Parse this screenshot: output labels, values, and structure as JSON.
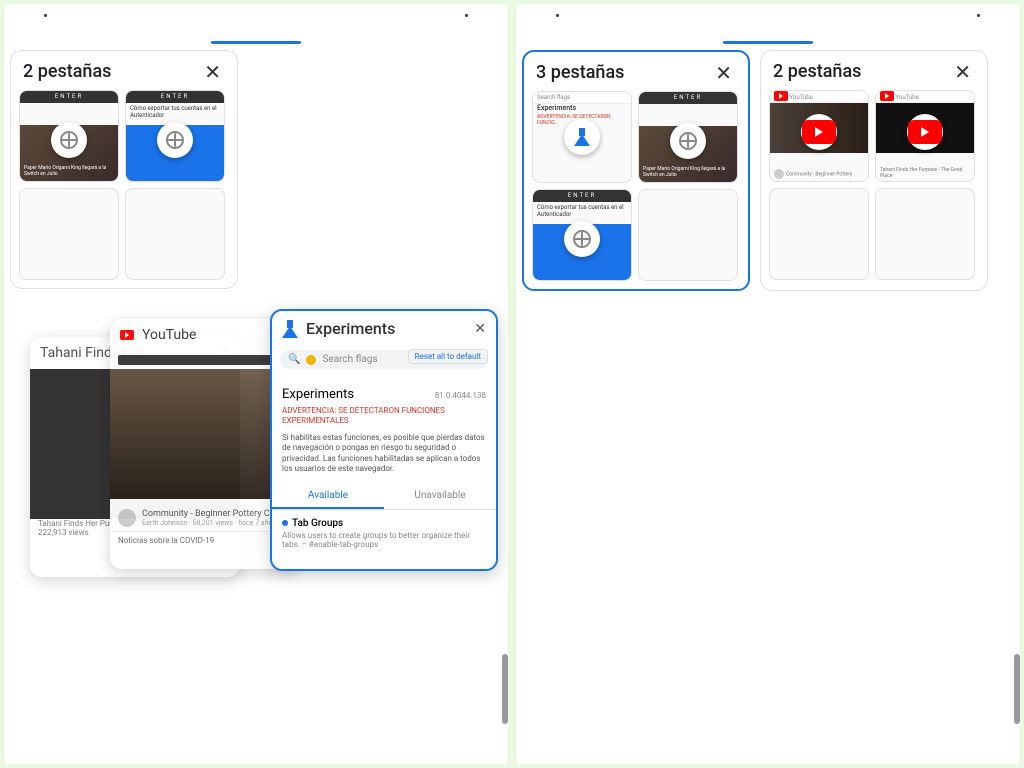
{
  "left": {
    "group1": {
      "title": "2 pestañas",
      "tab1_header": "ENTER",
      "tab1_caption": "Paper Mario Origami King llegará a la Switch en Julio",
      "tab2_header": "ENTER",
      "tab2_caption": "Cómo exportar tus cuentas en el Autenticador"
    },
    "back_card": {
      "title": "Tahani Finds Her",
      "meta1": "Tahani Finds Her Purpose - The Good Place",
      "meta2": "222,913 views"
    },
    "mid_card": {
      "title": "YouTube",
      "row_title": "Community - Beginner Pottery Clip 2",
      "row_meta": "Earth Johnson · 58,201 views · hace 7 años",
      "footer": "Noticias sobre la COVID-19"
    },
    "exp_card": {
      "title": "Experiments",
      "search_ph": "Search flags",
      "reset": "Reset all to default",
      "subtitle": "Experiments",
      "version": "81.0.4044.138",
      "warn": "ADVERTENCIA: SE DETECTARON FUNCIONES EXPERIMENTALES",
      "desc": "Si habilitas estas funciones, es posible que pierdas datos de navegación o pongas en riesgo tu seguridad o privacidad. Las funciones habilitadas se aplican a todos los usuarios de este navegador.",
      "tab_available": "Available",
      "tab_unavailable": "Unavailable",
      "flag_name": "Tab Groups",
      "flag_desc": "Allows users to create groups to better organize their tabs. – #enable-tab-groups"
    }
  },
  "right": {
    "group1": {
      "title": "3 pestañas",
      "tab1_title": "Experiments",
      "tab2_header": "ENTER",
      "tab2_caption": "Paper Mario Origami King llegará a la Switch en Julio",
      "tab3_header": "ENTER",
      "tab3_caption": "Cómo exportar tus cuentas en el Autenticador"
    },
    "group2": {
      "title": "2 pestañas",
      "tab1_title": "YouTube",
      "tab2_title": "YouTube",
      "tab2_caption": "Tahani Finds Her Purpose - The Good Place"
    }
  }
}
